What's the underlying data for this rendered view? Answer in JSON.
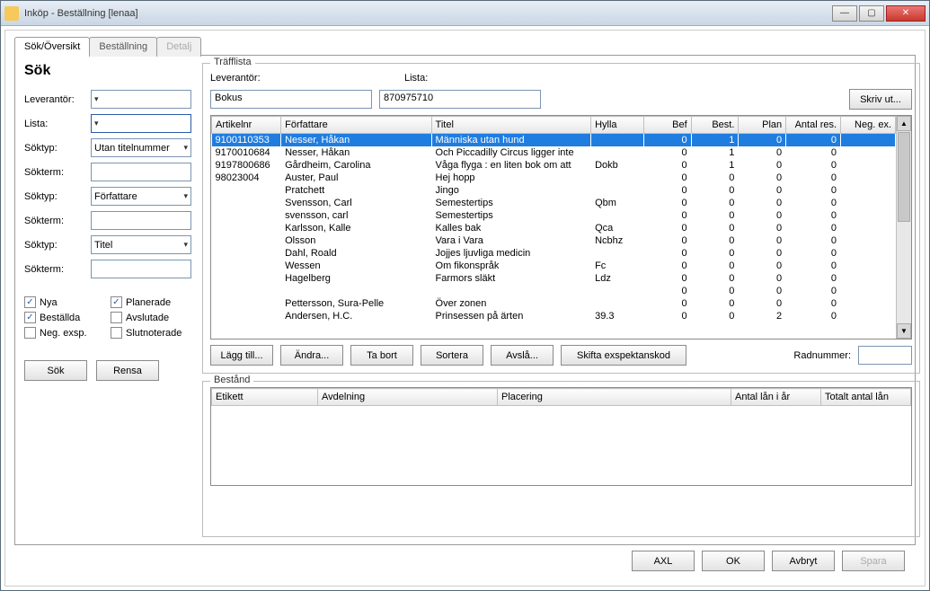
{
  "window": {
    "title": "Inköp - Beställning [lenaa]"
  },
  "tabs": {
    "t0": "Sök/Översikt",
    "t1": "Beställning",
    "t2": "Detalj"
  },
  "search": {
    "heading": "Sök",
    "labels": {
      "leverantor": "Leverantör:",
      "lista": "Lista:",
      "soktyp": "Söktyp:",
      "sokterm": "Sökterm:"
    },
    "soktyp1": "Utan titelnummer",
    "soktyp2": "Författare",
    "soktyp3": "Titel",
    "checks": {
      "nya": "Nya",
      "planerade": "Planerade",
      "bestallda": "Beställda",
      "avslutade": "Avslutade",
      "negexsp": "Neg. exsp.",
      "slutnoterade": "Slutnoterade"
    },
    "btn_search": "Sök",
    "btn_clear": "Rensa"
  },
  "trafflista": {
    "legend": "Träfflista",
    "lbl_leverantor": "Leverantör:",
    "lbl_lista": "Lista:",
    "val_leverantor": "Bokus",
    "val_lista": "870975710",
    "btn_print": "Skriv ut...",
    "headers": {
      "artikelnr": "Artikelnr",
      "forfattare": "Författare",
      "titel": "Titel",
      "hylla": "Hylla",
      "bef": "Bef",
      "best": "Best.",
      "plan": "Plan",
      "antalres": "Antal res.",
      "negex": "Neg. ex."
    },
    "rows": [
      {
        "art": "9100110353",
        "forf": "Nesser, Håkan",
        "titel": "Människa utan hund",
        "hylla": "",
        "bef": 0,
        "best": 1,
        "plan": 0,
        "antal": 0
      },
      {
        "art": "9170010684",
        "forf": "Nesser, Håkan",
        "titel": "Och Piccadilly Circus ligger inte",
        "hylla": "",
        "bef": 0,
        "best": 1,
        "plan": 0,
        "antal": 0
      },
      {
        "art": "9197800686",
        "forf": "Gårdheim, Carolina",
        "titel": "Våga flyga : en liten bok om att",
        "hylla": "Dokb",
        "bef": 0,
        "best": 1,
        "plan": 0,
        "antal": 0
      },
      {
        "art": "98023004",
        "forf": "Auster, Paul",
        "titel": "Hej hopp",
        "hylla": "",
        "bef": 0,
        "best": 0,
        "plan": 0,
        "antal": 0
      },
      {
        "art": "",
        "forf": "Pratchett",
        "titel": "Jingo",
        "hylla": "",
        "bef": 0,
        "best": 0,
        "plan": 0,
        "antal": 0
      },
      {
        "art": "",
        "forf": "Svensson, Carl",
        "titel": "Semestertips",
        "hylla": "Qbm",
        "bef": 0,
        "best": 0,
        "plan": 0,
        "antal": 0
      },
      {
        "art": "",
        "forf": "svensson, carl",
        "titel": "Semestertips",
        "hylla": "",
        "bef": 0,
        "best": 0,
        "plan": 0,
        "antal": 0
      },
      {
        "art": "",
        "forf": "Karlsson, Kalle",
        "titel": "Kalles bak",
        "hylla": "Qca",
        "bef": 0,
        "best": 0,
        "plan": 0,
        "antal": 0
      },
      {
        "art": "",
        "forf": "Olsson",
        "titel": "Vara i Vara",
        "hylla": "Ncbhz",
        "bef": 0,
        "best": 0,
        "plan": 0,
        "antal": 0
      },
      {
        "art": "",
        "forf": "Dahl, Roald",
        "titel": "Jojjes ljuvliga medicin",
        "hylla": "",
        "bef": 0,
        "best": 0,
        "plan": 0,
        "antal": 0
      },
      {
        "art": "",
        "forf": "Wessen",
        "titel": "Om fikonspråk",
        "hylla": "Fc",
        "bef": 0,
        "best": 0,
        "plan": 0,
        "antal": 0
      },
      {
        "art": "",
        "forf": "Hagelberg",
        "titel": "Farmors släkt",
        "hylla": "Ldz",
        "bef": 0,
        "best": 0,
        "plan": 0,
        "antal": 0
      },
      {
        "art": "",
        "forf": "",
        "titel": "",
        "hylla": "",
        "bef": 0,
        "best": 0,
        "plan": 0,
        "antal": 0
      },
      {
        "art": "",
        "forf": "Pettersson, Sura-Pelle",
        "titel": "Över zonen",
        "hylla": "",
        "bef": 0,
        "best": 0,
        "plan": 0,
        "antal": 0
      },
      {
        "art": "",
        "forf": "Andersen, H.C.",
        "titel": "Prinsessen på ärten",
        "hylla": "39.3",
        "bef": 0,
        "best": 0,
        "plan": 2,
        "antal": 0
      }
    ],
    "actions": {
      "add": "Lägg till...",
      "edit": "Ändra...",
      "remove": "Ta bort",
      "sort": "Sortera",
      "reject": "Avslå...",
      "shift": "Skifta exspektanskod",
      "rownum_label": "Radnummer:"
    }
  },
  "bestand": {
    "legend": "Bestånd",
    "headers": {
      "etikett": "Etikett",
      "avdelning": "Avdelning",
      "placering": "Placering",
      "antal": "Antal lån i år",
      "totalt": "Totalt antal lån"
    }
  },
  "bottom": {
    "axl": "AXL",
    "ok": "OK",
    "avbryt": "Avbryt",
    "spara": "Spara"
  }
}
